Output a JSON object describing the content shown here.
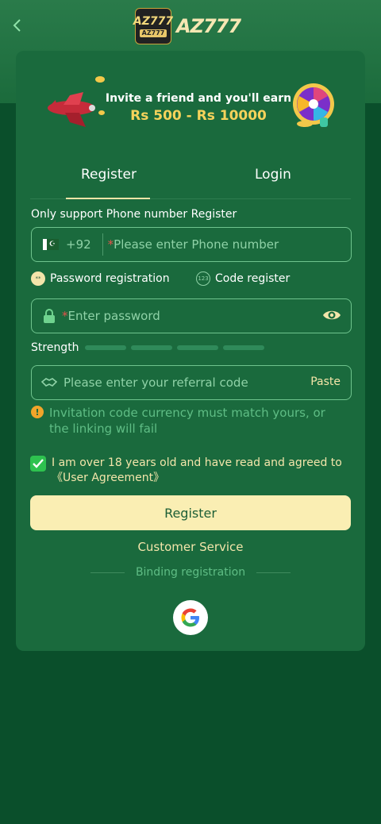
{
  "header": {
    "logo_small_text": "AZ777",
    "logo_small_sub": "AZ777",
    "logo_text": "AZ777"
  },
  "banner": {
    "line1": "Invite a friend and you'll earn",
    "line2": "Rs 500 - Rs 10000"
  },
  "tabs": [
    {
      "label": "Register",
      "active": true
    },
    {
      "label": "Login",
      "active": false
    }
  ],
  "form": {
    "support_label": "Only support Phone number Register",
    "phone": {
      "country_code": "+92",
      "placeholder": "Please enter Phone number"
    },
    "options": {
      "password_label": "Password registration",
      "code_label": "Code register"
    },
    "password": {
      "placeholder": "Enter password"
    },
    "strength_label": "Strength",
    "referral": {
      "placeholder": "Please enter your referral code",
      "paste_label": "Paste"
    },
    "warning": "Invitation code currency must match yours, or the linking will fail",
    "agreement": {
      "checked": true,
      "text": "I am over 18 years old and have read and agreed to",
      "link": "《User Agreement》"
    },
    "submit_label": "Register",
    "customer_service": "Customer Service",
    "binding_label": "Binding registration"
  },
  "colors": {
    "background": "#0a4f2b",
    "card": "#1a6a3d",
    "accent": "#faeeb3",
    "input_border": "#6fc48e"
  },
  "icons": [
    "back-arrow-icon",
    "pakistan-flag-icon",
    "password-icon",
    "code-icon",
    "lock-icon",
    "eye-icon",
    "handshake-icon",
    "warning-icon",
    "check-icon",
    "google-icon"
  ]
}
